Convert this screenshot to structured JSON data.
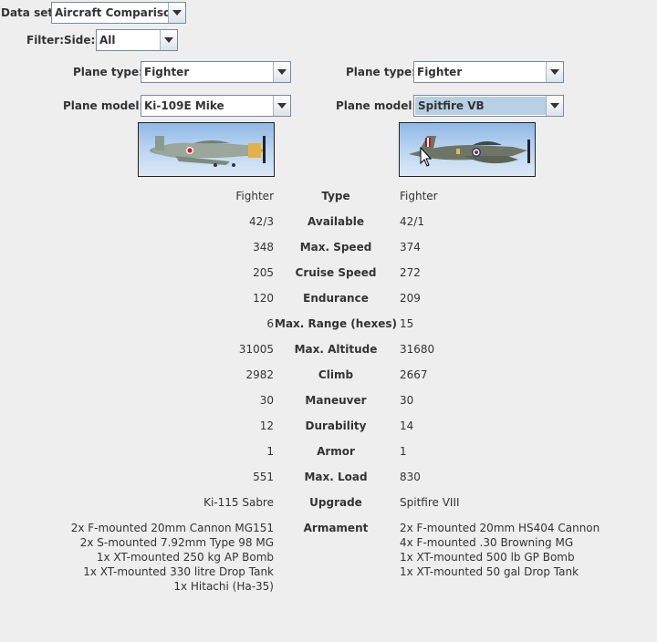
{
  "top": {
    "dataset_label": "Data set:",
    "dataset_value": "Aircraft Comparison",
    "filter_label": "Filter:",
    "side_label": "Side:",
    "side_value": "All"
  },
  "left": {
    "plane_type_label": "Plane type:",
    "plane_type_value": "Fighter",
    "plane_model_label": "Plane model:",
    "plane_model_value": "Ki-109E Mike"
  },
  "right": {
    "plane_type_label": "Plane type:",
    "plane_type_value": "Fighter",
    "plane_model_label": "Plane model:",
    "plane_model_value": "Spitfire VB"
  },
  "stats": [
    {
      "label": "Type",
      "left": "Fighter",
      "right": "Fighter"
    },
    {
      "label": "Available",
      "left": "42/3",
      "right": "42/1"
    },
    {
      "label": "Max. Speed",
      "left": "348",
      "right": "374"
    },
    {
      "label": "Cruise Speed",
      "left": "205",
      "right": "272"
    },
    {
      "label": "Endurance",
      "left": "120",
      "right": "209"
    },
    {
      "label": "Max. Range (hexes)",
      "left": "6",
      "right": "15"
    },
    {
      "label": "Max. Altitude",
      "left": "31005",
      "right": "31680"
    },
    {
      "label": "Climb",
      "left": "2982",
      "right": "2667"
    },
    {
      "label": "Maneuver",
      "left": "30",
      "right": "30"
    },
    {
      "label": "Durability",
      "left": "12",
      "right": "14"
    },
    {
      "label": "Armor",
      "left": "1",
      "right": "1"
    },
    {
      "label": "Max. Load",
      "left": "551",
      "right": "830"
    },
    {
      "label": "Upgrade",
      "left": "Ki-115 Sabre",
      "right": "Spitfire VIII"
    }
  ],
  "armament": {
    "label": "Armament",
    "left": [
      "2x F-mounted 20mm Cannon MG151",
      "2x S-mounted 7.92mm Type 98 MG",
      "1x XT-mounted 250 kg AP Bomb",
      "1x XT-mounted 330 litre Drop Tank",
      "1x Hitachi (Ha-35)"
    ],
    "right": [
      "2x F-mounted 20mm HS404 Cannon",
      "4x F-mounted .30 Browning MG",
      "1x XT-mounted 500 lb GP Bomb",
      "1x XT-mounted 50 gal Drop Tank"
    ]
  }
}
